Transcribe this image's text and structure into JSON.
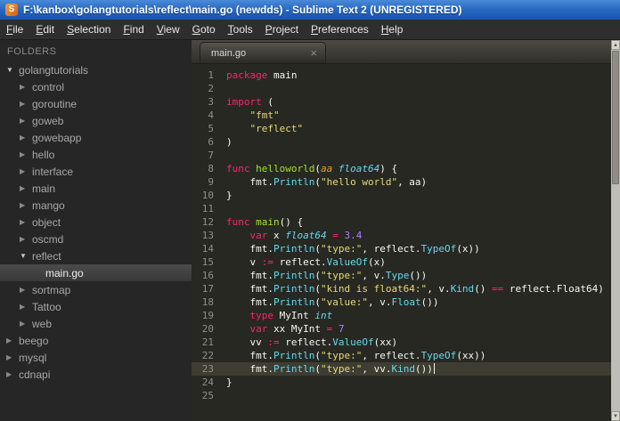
{
  "window": {
    "title": "F:\\kanbox\\golangtutorials\\reflect\\main.go (newdds) - Sublime Text 2 (UNREGISTERED)",
    "app_icon_letter": "S"
  },
  "menu": {
    "items": [
      {
        "label": "File",
        "u": 0
      },
      {
        "label": "Edit",
        "u": 0
      },
      {
        "label": "Selection",
        "u": 0
      },
      {
        "label": "Find",
        "u": 0
      },
      {
        "label": "View",
        "u": 0
      },
      {
        "label": "Goto",
        "u": 0
      },
      {
        "label": "Tools",
        "u": 0
      },
      {
        "label": "Project",
        "u": 0
      },
      {
        "label": "Preferences",
        "u": 0
      },
      {
        "label": "Help",
        "u": 0
      }
    ]
  },
  "sidebar": {
    "header": "FOLDERS",
    "items": [
      {
        "label": "golangtutorials",
        "level": 0,
        "arrow": "down",
        "selected": false
      },
      {
        "label": "control",
        "level": 1,
        "arrow": "right",
        "selected": false
      },
      {
        "label": "goroutine",
        "level": 1,
        "arrow": "right",
        "selected": false
      },
      {
        "label": "goweb",
        "level": 1,
        "arrow": "right",
        "selected": false
      },
      {
        "label": "gowebapp",
        "level": 1,
        "arrow": "right",
        "selected": false
      },
      {
        "label": "hello",
        "level": 1,
        "arrow": "right",
        "selected": false
      },
      {
        "label": "interface",
        "level": 1,
        "arrow": "right",
        "selected": false
      },
      {
        "label": "main",
        "level": 1,
        "arrow": "right",
        "selected": false
      },
      {
        "label": "mango",
        "level": 1,
        "arrow": "right",
        "selected": false
      },
      {
        "label": "object",
        "level": 1,
        "arrow": "right",
        "selected": false
      },
      {
        "label": "oscmd",
        "level": 1,
        "arrow": "right",
        "selected": false
      },
      {
        "label": "reflect",
        "level": 1,
        "arrow": "down",
        "selected": false
      },
      {
        "label": "main.go",
        "level": 2,
        "arrow": "none",
        "selected": true
      },
      {
        "label": "sortmap",
        "level": 1,
        "arrow": "right",
        "selected": false
      },
      {
        "label": "Tattoo",
        "level": 1,
        "arrow": "right",
        "selected": false
      },
      {
        "label": "web",
        "level": 1,
        "arrow": "right",
        "selected": false
      },
      {
        "label": "beego",
        "level": 0,
        "arrow": "right",
        "selected": false
      },
      {
        "label": "mysql",
        "level": 0,
        "arrow": "right",
        "selected": false
      },
      {
        "label": "cdnapi",
        "level": 0,
        "arrow": "right",
        "selected": false
      }
    ]
  },
  "tabs": [
    {
      "label": "main.go",
      "active": true,
      "close_glyph": "×"
    }
  ],
  "theme": {
    "editor_bg": "#272822",
    "current_line_bg": "#3e3d32",
    "line_number": "#8f908a",
    "keyword": "#f92672",
    "type": "#66d9ef",
    "function_call": "#66d9ef",
    "function_name": "#a6e22e",
    "string": "#e6db74",
    "number": "#ae81ff",
    "parameter": "#fd971f",
    "plain": "#f8f8f2",
    "titlebar_blue": "#2365c0"
  },
  "editor": {
    "lines": [
      {
        "n": 1,
        "s": [
          [
            "kw",
            "package"
          ],
          [
            "pl",
            " main"
          ]
        ]
      },
      {
        "n": 2,
        "s": []
      },
      {
        "n": 3,
        "s": [
          [
            "kw",
            "import"
          ],
          [
            "pl",
            " ("
          ]
        ]
      },
      {
        "n": 4,
        "s": [
          [
            "pl",
            "    "
          ],
          [
            "str",
            "\"fmt\""
          ]
        ]
      },
      {
        "n": 5,
        "s": [
          [
            "pl",
            "    "
          ],
          [
            "str",
            "\"reflect\""
          ]
        ]
      },
      {
        "n": 6,
        "s": [
          [
            "pl",
            ")"
          ]
        ]
      },
      {
        "n": 7,
        "s": []
      },
      {
        "n": 8,
        "s": [
          [
            "kw",
            "func "
          ],
          [
            "fn",
            "helloworld"
          ],
          [
            "pl",
            "("
          ],
          [
            "pr",
            "aa"
          ],
          [
            "pl",
            " "
          ],
          [
            "ty",
            "float64"
          ],
          [
            "pl",
            ") {"
          ]
        ]
      },
      {
        "n": 9,
        "s": [
          [
            "pl",
            "    fmt."
          ],
          [
            "fc",
            "Println"
          ],
          [
            "pl",
            "("
          ],
          [
            "str",
            "\"hello world\""
          ],
          [
            "pl",
            ", aa)"
          ]
        ]
      },
      {
        "n": 10,
        "s": [
          [
            "pl",
            "}"
          ]
        ]
      },
      {
        "n": 11,
        "s": []
      },
      {
        "n": 12,
        "s": [
          [
            "kw",
            "func "
          ],
          [
            "fn",
            "main"
          ],
          [
            "pl",
            "() {"
          ]
        ]
      },
      {
        "n": 13,
        "s": [
          [
            "pl",
            "    "
          ],
          [
            "kw",
            "var"
          ],
          [
            "pl",
            " x "
          ],
          [
            "ty",
            "float64"
          ],
          [
            "pl",
            " "
          ],
          [
            "kw",
            "="
          ],
          [
            "pl",
            " "
          ],
          [
            "num",
            "3.4"
          ]
        ]
      },
      {
        "n": 14,
        "s": [
          [
            "pl",
            "    fmt."
          ],
          [
            "fc",
            "Println"
          ],
          [
            "pl",
            "("
          ],
          [
            "str",
            "\"type:\""
          ],
          [
            "pl",
            ", reflect."
          ],
          [
            "fc",
            "TypeOf"
          ],
          [
            "pl",
            "(x))"
          ]
        ]
      },
      {
        "n": 15,
        "s": [
          [
            "pl",
            "    v "
          ],
          [
            "kw",
            ":="
          ],
          [
            "pl",
            " reflect."
          ],
          [
            "fc",
            "ValueOf"
          ],
          [
            "pl",
            "(x)"
          ]
        ]
      },
      {
        "n": 16,
        "s": [
          [
            "pl",
            "    fmt."
          ],
          [
            "fc",
            "Println"
          ],
          [
            "pl",
            "("
          ],
          [
            "str",
            "\"type:\""
          ],
          [
            "pl",
            ", v."
          ],
          [
            "fc",
            "Type"
          ],
          [
            "pl",
            "())"
          ]
        ]
      },
      {
        "n": 17,
        "s": [
          [
            "pl",
            "    fmt."
          ],
          [
            "fc",
            "Println"
          ],
          [
            "pl",
            "("
          ],
          [
            "str",
            "\"kind is float64:\""
          ],
          [
            "pl",
            ", v."
          ],
          [
            "fc",
            "Kind"
          ],
          [
            "pl",
            "() "
          ],
          [
            "kw",
            "=="
          ],
          [
            "pl",
            " reflect.Float64)"
          ]
        ]
      },
      {
        "n": 18,
        "s": [
          [
            "pl",
            "    fmt."
          ],
          [
            "fc",
            "Println"
          ],
          [
            "pl",
            "("
          ],
          [
            "str",
            "\"value:\""
          ],
          [
            "pl",
            ", v."
          ],
          [
            "fc",
            "Float"
          ],
          [
            "pl",
            "())"
          ]
        ]
      },
      {
        "n": 19,
        "s": [
          [
            "pl",
            "    "
          ],
          [
            "kw",
            "type"
          ],
          [
            "pl",
            " MyInt "
          ],
          [
            "ty",
            "int"
          ]
        ]
      },
      {
        "n": 20,
        "s": [
          [
            "pl",
            "    "
          ],
          [
            "kw",
            "var"
          ],
          [
            "pl",
            " xx MyInt "
          ],
          [
            "kw",
            "="
          ],
          [
            "pl",
            " "
          ],
          [
            "num",
            "7"
          ]
        ]
      },
      {
        "n": 21,
        "s": [
          [
            "pl",
            "    vv "
          ],
          [
            "kw",
            ":="
          ],
          [
            "pl",
            " reflect."
          ],
          [
            "fc",
            "ValueOf"
          ],
          [
            "pl",
            "(xx)"
          ]
        ]
      },
      {
        "n": 22,
        "s": [
          [
            "pl",
            "    fmt."
          ],
          [
            "fc",
            "Println"
          ],
          [
            "pl",
            "("
          ],
          [
            "str",
            "\"type:\""
          ],
          [
            "pl",
            ", reflect."
          ],
          [
            "fc",
            "TypeOf"
          ],
          [
            "pl",
            "(xx))"
          ]
        ]
      },
      {
        "n": 23,
        "s": [
          [
            "pl",
            "    fmt."
          ],
          [
            "fc",
            "Println"
          ],
          [
            "pl",
            "("
          ],
          [
            "str",
            "\"type:\""
          ],
          [
            "pl",
            ", vv."
          ],
          [
            "fc",
            "Kind"
          ],
          [
            "pl",
            "())"
          ]
        ],
        "cur": true,
        "caret": true
      },
      {
        "n": 24,
        "s": [
          [
            "pl",
            "}"
          ]
        ]
      },
      {
        "n": 25,
        "s": []
      }
    ]
  },
  "scrollbar": {
    "up_glyph": "▲",
    "down_glyph": "▼"
  }
}
